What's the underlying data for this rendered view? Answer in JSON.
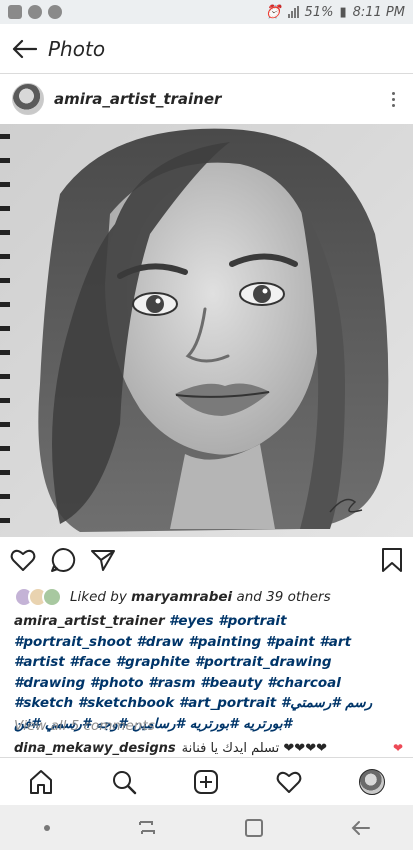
{
  "status_bar": {
    "battery": "51%",
    "time": "8:11 PM",
    "icons": [
      "facebook-icon",
      "whatsapp-icon",
      "messenger-icon",
      "alarm-icon",
      "vibrate-icon",
      "signal-icon",
      "battery-icon"
    ]
  },
  "header": {
    "title": "Photo",
    "back_icon": "arrow-left-icon"
  },
  "post": {
    "username": "amira_artist_trainer",
    "more_icon": "more-vertical-icon",
    "image_description_icon": "pencil-portrait-photo",
    "actions": [
      "heart-icon",
      "comment-icon",
      "share-icon",
      "bookmark-icon"
    ],
    "likes": {
      "prefix": "Liked by",
      "user": "maryamrabei",
      "suffix": "and 39 others"
    },
    "caption": {
      "author": "amira_artist_trainer",
      "text": "#eyes #portrait #portrait_shoot #draw #painting #paint #art #artist #face #graphite #portrait_drawing #drawing #photo #rasm #beauty #charcoal #sketch #sketchbook #art_portrait #رسم #رسمتي #بورتريه #بورتريه #رسامين #وجه #رسمي #فن"
    },
    "view_all": "View all 5 comments",
    "comment": {
      "user": "dina_mekawy_designs",
      "text": "تسلم ايدك يا فنانة ❤❤❤❤"
    }
  },
  "bottom_nav": [
    "home-icon",
    "search-icon",
    "add-post-icon",
    "activity-heart-icon",
    "profile-avatar"
  ],
  "system_nav": [
    "dot-icon",
    "recent-apps-icon",
    "home-square-icon",
    "back-arrow-icon"
  ],
  "colors": {
    "text": "#262626",
    "hashtag": "#003569",
    "muted": "#8e8e8e",
    "like_red": "#ed4956"
  }
}
